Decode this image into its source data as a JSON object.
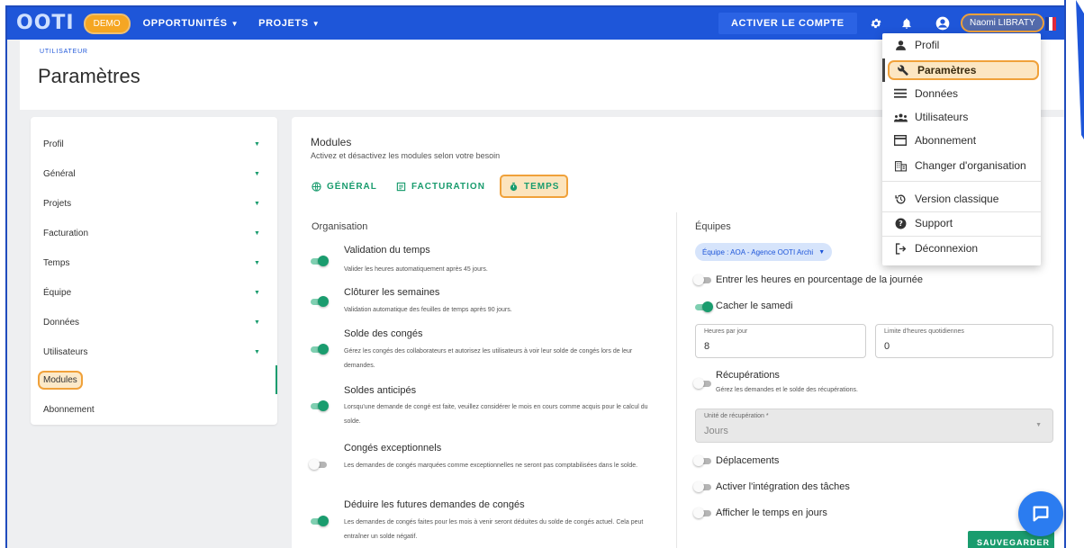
{
  "topbar": {
    "logo": "OOTI",
    "demo_badge": "DEMO",
    "nav": [
      {
        "label": "OPPORTUNITÉS"
      },
      {
        "label": "PROJETS"
      }
    ],
    "activate_label": "ACTIVER LE COMPTE",
    "user_name": "Naomi LIBRATY",
    "accent_color": "#1e56d9"
  },
  "header": {
    "breadcrumb": "UTILISATEUR",
    "title": "Paramètres"
  },
  "sidebar": {
    "items": [
      {
        "label": "Profil"
      },
      {
        "label": "Général"
      },
      {
        "label": "Projets"
      },
      {
        "label": "Facturation"
      },
      {
        "label": "Temps"
      },
      {
        "label": "Équipe"
      },
      {
        "label": "Données"
      },
      {
        "label": "Utilisateurs"
      },
      {
        "label": "Modules"
      },
      {
        "label": "Abonnement"
      }
    ]
  },
  "main": {
    "title": "Modules",
    "subtitle": "Activez et désactivez les modules selon votre besoin",
    "tabs": [
      {
        "label": "GÉNÉRAL",
        "icon": "globe-icon"
      },
      {
        "label": "FACTURATION",
        "icon": "invoice-icon"
      },
      {
        "label": "TEMPS",
        "icon": "timer-icon"
      }
    ],
    "left_section": "Organisation",
    "left_options": [
      {
        "title": "Validation du temps",
        "desc": "Valider les heures automatiquement après 45 jours.",
        "on": true
      },
      {
        "title": "Clôturer les semaines",
        "desc": "Validation automatique des feuilles de temps après 90 jours.",
        "on": true
      },
      {
        "title": "Solde des congés",
        "desc": "Gérez les congés des collaborateurs et autorisez les utilisateurs à voir leur solde de congés lors de leur demandes.",
        "on": true
      },
      {
        "title": "Soldes anticipés",
        "desc": "Lorsqu'une demande de congé est faite, veuillez considérer le mois en cours comme acquis pour le calcul du solde.",
        "on": true
      },
      {
        "title": "Congés exceptionnels",
        "desc": "Les demandes de congés marquées comme exceptionnelles ne seront pas comptabilisées dans le solde.",
        "on": false
      },
      {
        "title": "Déduire les futures demandes de congés",
        "desc": "Les demandes de congés faites pour les mois à venir seront déduites du solde de congés actuel. Cela peut entraîner un solde négatif.",
        "on": true
      }
    ],
    "right_section": "Équipes",
    "team_chip": "Équipe : AOA - Agence OOTI Archi",
    "right_options": {
      "percentage": {
        "label": "Entrer les heures en pourcentage de la journée",
        "on": false
      },
      "hide_saturday": {
        "label": "Cacher le samedi",
        "on": true
      },
      "recuperations": {
        "label": "Récupérations",
        "desc": "Gérez les demandes et le solde des récupérations.",
        "on": false
      },
      "deplacements": {
        "label": "Déplacements",
        "on": false
      },
      "tasks": {
        "label": "Activer l'intégration des tâches",
        "on": false
      },
      "days": {
        "label": "Afficher le temps en jours",
        "on": false
      }
    },
    "fields": {
      "hours_per_day": {
        "label": "Heures par jour",
        "value": "8"
      },
      "daily_limit": {
        "label": "Limite d'heures quotidiennes",
        "value": "0"
      },
      "recup_unit": {
        "label": "Unité de récupération *",
        "value": "Jours"
      }
    },
    "save_label": "SAUVEGARDER"
  },
  "menu": {
    "items": [
      {
        "label": "Profil",
        "icon": "person-icon"
      },
      {
        "label": "Paramètres",
        "icon": "wrench-icon"
      },
      {
        "label": "Données",
        "icon": "list-icon"
      },
      {
        "label": "Utilisateurs",
        "icon": "group-icon"
      },
      {
        "label": "Abonnement",
        "icon": "card-icon"
      },
      {
        "label": "Changer d'organisation",
        "icon": "building-icon"
      },
      {
        "label": "Version classique",
        "icon": "history-icon"
      },
      {
        "label": "Support",
        "icon": "help-icon"
      },
      {
        "label": "Déconnexion",
        "icon": "logout-icon"
      }
    ]
  },
  "colors": {
    "primary_blue": "#1e56d9",
    "green": "#1a9c6e",
    "highlight_orange": "#f0a13a"
  }
}
